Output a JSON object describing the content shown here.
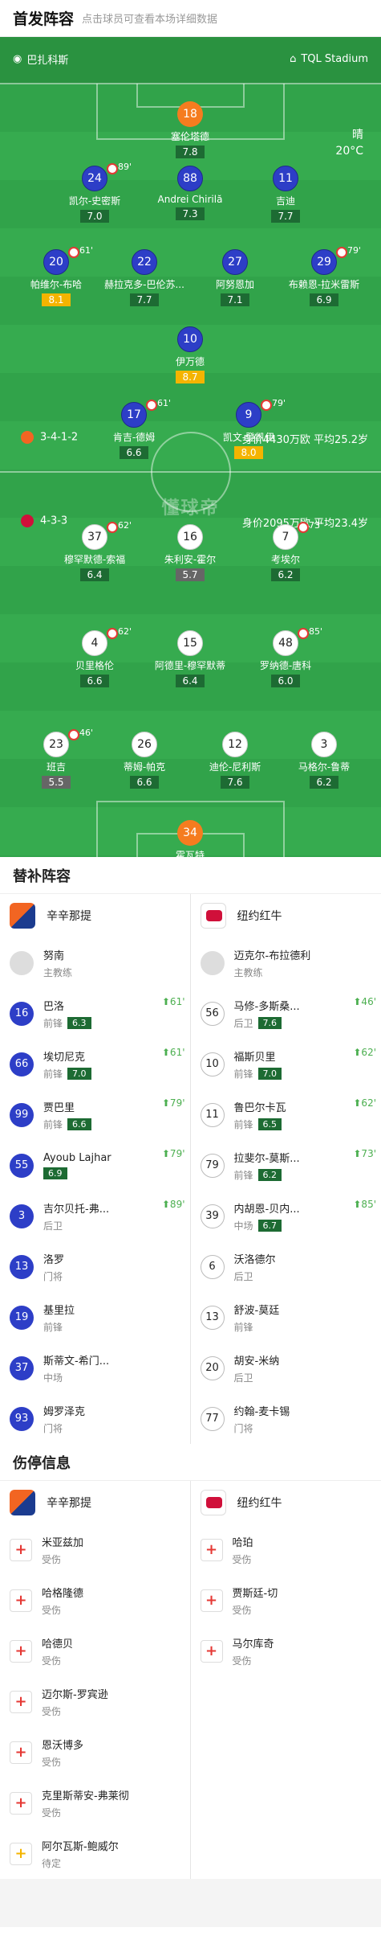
{
  "header": {
    "title": "首发阵容",
    "subtitle": "点击球员可查看本场详细数据"
  },
  "pitch": {
    "home_team": "巴扎科斯",
    "venue": "TQL Stadium",
    "weather": "晴",
    "temperature": "20°C",
    "watermark": "懂球帝",
    "home_formation": "3-4-1-2",
    "home_value": "身价4430万欧 平均25.2岁",
    "away_formation": "4-3-3",
    "away_value": "身价2095万欧 平均23.4岁",
    "home_players": [
      {
        "num": "18",
        "name": "塞伦塔德",
        "rating": "7.8",
        "style": "orange"
      },
      {
        "num": "24",
        "name": "凯尔-史密斯",
        "rating": "7.0",
        "sub": "89'"
      },
      {
        "num": "88",
        "name": "Andrei Chirilă",
        "rating": "7.3"
      },
      {
        "num": "11",
        "name": "吉迪",
        "rating": "7.7"
      },
      {
        "num": "20",
        "name": "帕维尔-布哈",
        "rating": "8.1",
        "sub": "61'",
        "gold": true
      },
      {
        "num": "22",
        "name": "赫拉克多-巴伦苏...",
        "rating": "7.7"
      },
      {
        "num": "27",
        "name": "阿努恩加",
        "rating": "7.1"
      },
      {
        "num": "29",
        "name": "布赖恩-拉米雷斯",
        "rating": "6.9",
        "sub": "79'"
      },
      {
        "num": "10",
        "name": "伊万德",
        "rating": "8.7",
        "gold": true
      },
      {
        "num": "17",
        "name": "肯吉-德姆",
        "rating": "6.6",
        "sub": "61'"
      },
      {
        "num": "9",
        "name": "凯文-登凯伊",
        "rating": "8.0",
        "sub": "79'",
        "gold": true
      }
    ],
    "away_players": [
      {
        "num": "37",
        "name": "穆罕默德-索福",
        "rating": "6.4",
        "sub": "62'"
      },
      {
        "num": "16",
        "name": "朱利安-霍尔",
        "rating": "5.7",
        "grey": true
      },
      {
        "num": "7",
        "name": "考埃尔",
        "rating": "6.2",
        "sub": "73'"
      },
      {
        "num": "4",
        "name": "贝里格伦",
        "rating": "6.6",
        "sub": "62'"
      },
      {
        "num": "15",
        "name": "阿德里-穆罕默蒂",
        "rating": "6.4"
      },
      {
        "num": "48",
        "name": "罗纳德-唐科",
        "rating": "6.0",
        "sub": "85'"
      },
      {
        "num": "23",
        "name": "班吉",
        "rating": "5.5",
        "sub": "46'",
        "grey": true
      },
      {
        "num": "26",
        "name": "蒂姆-帕克",
        "rating": "6.6"
      },
      {
        "num": "12",
        "name": "迪伦-尼利斯",
        "rating": "7.6"
      },
      {
        "num": "3",
        "name": "马格尔-鲁蒂",
        "rating": "6.2"
      },
      {
        "num": "34",
        "name": "霍瓦特",
        "rating": "7.5",
        "style": "orange"
      }
    ]
  },
  "subs": {
    "title": "替补阵容",
    "home_team": "辛辛那提",
    "away_team": "纽约红牛",
    "home": [
      {
        "name": "努南",
        "role": "主教练",
        "coach": true
      },
      {
        "num": "16",
        "name": "巴洛",
        "role": "前锋",
        "rating": "6.3",
        "min": "61'"
      },
      {
        "num": "66",
        "name": "埃切尼克",
        "role": "前锋",
        "rating": "7.0",
        "min": "61'"
      },
      {
        "num": "99",
        "name": "贾巴里",
        "role": "前锋",
        "rating": "6.6",
        "min": "79'"
      },
      {
        "num": "55",
        "name": "Ayoub Lajhar",
        "role": "",
        "rating": "6.9",
        "min": "79'"
      },
      {
        "num": "3",
        "name": "吉尔贝托-弗...",
        "role": "后卫",
        "min": "89'"
      },
      {
        "num": "13",
        "name": "洛罗",
        "role": "门将"
      },
      {
        "num": "19",
        "name": "基里拉",
        "role": "前锋"
      },
      {
        "num": "37",
        "name": "斯蒂文-希门...",
        "role": "中场"
      },
      {
        "num": "93",
        "name": "姆罗泽克",
        "role": "门将"
      }
    ],
    "away": [
      {
        "name": "迈克尔-布拉德利",
        "role": "主教练",
        "coach": true
      },
      {
        "num": "56",
        "name": "马修-多斯桑...",
        "role": "后卫",
        "rating": "7.6",
        "min": "46'"
      },
      {
        "num": "10",
        "name": "福斯贝里",
        "role": "前锋",
        "rating": "7.0",
        "min": "62'"
      },
      {
        "num": "11",
        "name": "鲁巴尔卡瓦",
        "role": "前锋",
        "rating": "6.5",
        "min": "62'"
      },
      {
        "num": "79",
        "name": "拉斐尔-莫斯...",
        "role": "前锋",
        "rating": "6.2",
        "min": "73'"
      },
      {
        "num": "39",
        "name": "内胡恩-贝内...",
        "role": "中场",
        "rating": "6.7",
        "min": "85'"
      },
      {
        "num": "6",
        "name": "沃洛德尔",
        "role": "后卫"
      },
      {
        "num": "13",
        "name": "舒波-莫廷",
        "role": "前锋"
      },
      {
        "num": "20",
        "name": "胡安-米纳",
        "role": "后卫"
      },
      {
        "num": "77",
        "name": "约翰-麦卡锡",
        "role": "门将"
      }
    ]
  },
  "injuries": {
    "title": "伤停信息",
    "home_team": "辛辛那提",
    "away_team": "纽约红牛",
    "home": [
      {
        "name": "米亚兹加",
        "status": "受伤"
      },
      {
        "name": "哈格隆德",
        "status": "受伤"
      },
      {
        "name": "哈德贝",
        "status": "受伤"
      },
      {
        "name": "迈尔斯-罗宾逊",
        "status": "受伤"
      },
      {
        "name": "恩沃博多",
        "status": "受伤"
      },
      {
        "name": "克里斯蒂安-弗莱彻",
        "status": "受伤"
      },
      {
        "name": "阿尔瓦斯-鲍威尔",
        "status": "待定",
        "doubt": true
      }
    ],
    "away": [
      {
        "name": "哈珀",
        "status": "受伤"
      },
      {
        "name": "贾斯廷-切",
        "status": "受伤"
      },
      {
        "name": "马尔库奇",
        "status": "受伤"
      }
    ]
  }
}
